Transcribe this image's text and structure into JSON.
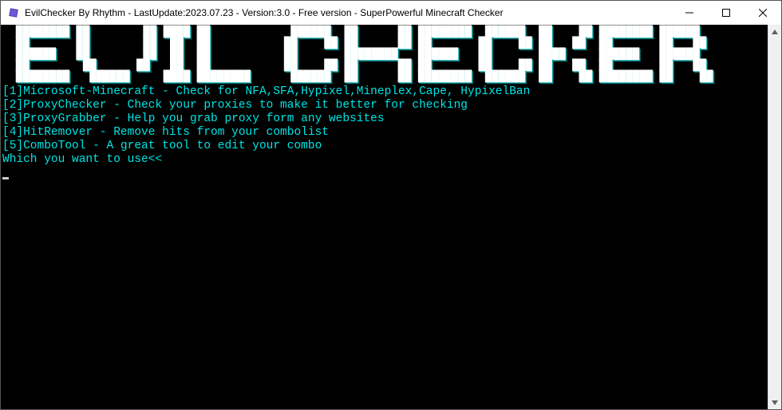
{
  "window": {
    "title": "EvilChecker By Rhythm - LastUpdate:2023.07.23 - Version:3.0 - Free version - SuperPowerful Minecraft Checker"
  },
  "ascii_banner": "  ████████ ██        ██ ████ ██            ██████  ██      ██ ████████  ██████  ██    ██ ████████ ██████  \n  ██       ██        ██  ██  ██           ██    ██ ██      ██ ██       ██    ██ ██   ██  ██       ██   ██ \n  ██████   ██        ██  ██  ██           ██       ████████   ██████   ██       ████     ██████   ██████  \n  ██        ██      ██   ██  ██           ██    ██ ██      ██ ██       ██    ██ ██   ██  ██       ██   ██ \n  ████████   ██████     ████ ████████      ██████  ██      ██ ████████  ██████  ██    ██ ████████ ██    ██",
  "menu": {
    "line1": "[1]Microsoft-Minecraft - Check for NFA,SFA,Hypixel,Mineplex,Cape, HypixelBan",
    "line2": "[2]ProxyChecker - Check your proxies to make it better for checking",
    "line3": "[3]ProxyGrabber - Help you grab proxy form any websites",
    "line4": "[4]HitRemover - Remove hits from your combolist",
    "line5": "[5]ComboTool - A great tool to edit your combo",
    "prompt": "Which you want to use<<"
  }
}
